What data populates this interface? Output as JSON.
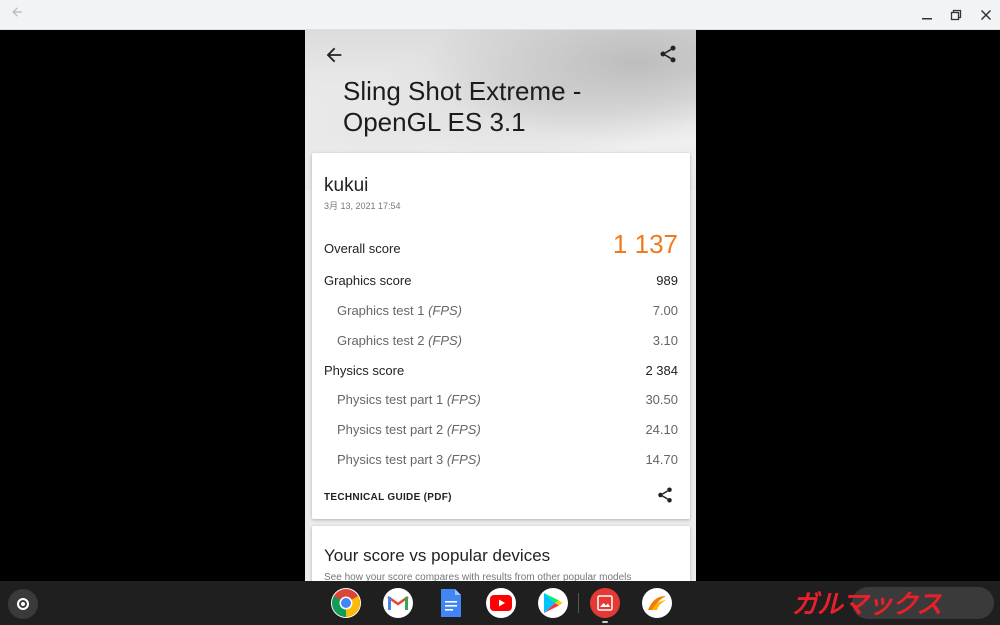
{
  "window": {
    "back_icon": "arrow-left-icon",
    "controls": [
      "minimize-icon",
      "restore-icon",
      "close-icon"
    ]
  },
  "header": {
    "title_line1": "Sling Shot Extreme -",
    "title_line2": "OpenGL ES 3.1"
  },
  "result": {
    "device": "kukui",
    "date": "3月 13, 2021 17:54",
    "overall_label": "Overall score",
    "overall_value": "1 137",
    "graphics_label": "Graphics score",
    "graphics_value": "989",
    "gt1_label": "Graphics test 1",
    "gt1_unit": "(FPS)",
    "gt1_value": "7.00",
    "gt2_label": "Graphics test 2",
    "gt2_unit": "(FPS)",
    "gt2_value": "3.10",
    "physics_label": "Physics score",
    "physics_value": "2 384",
    "pt1_label": "Physics test part 1",
    "pt1_unit": "(FPS)",
    "pt1_value": "30.50",
    "pt2_label": "Physics test part 2",
    "pt2_unit": "(FPS)",
    "pt2_value": "24.10",
    "pt3_label": "Physics test part 3",
    "pt3_unit": "(FPS)",
    "pt3_value": "14.70",
    "guide_label": "TECHNICAL GUIDE (PDF)"
  },
  "compare": {
    "title": "Your score vs popular devices",
    "subtitle": "See how your score compares with results from other popular models"
  },
  "shelf": {
    "apps": [
      "chrome-icon",
      "gmail-icon",
      "docs-icon",
      "youtube-icon",
      "play-store-icon",
      "gallery-icon",
      "3dmark-icon"
    ],
    "watermark": "ガルマックス"
  },
  "colors": {
    "accent": "#ef7a21",
    "shelf_bg": "#1f1f1f",
    "titlebar_bg": "#f1f3f4"
  }
}
